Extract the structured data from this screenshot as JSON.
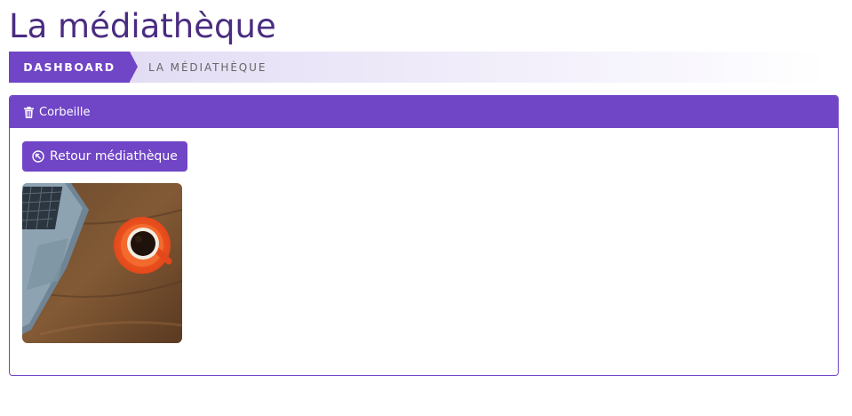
{
  "page": {
    "title": "La médiathèque"
  },
  "breadcrumb": {
    "items": [
      {
        "label": "DASHBOARD"
      },
      {
        "label": "LA MÉDIATHÈQUE"
      }
    ]
  },
  "panel": {
    "title": "Corbeille",
    "icon": "trash-icon"
  },
  "actions": {
    "back_label": "Retour médiathèque",
    "back_icon": "return-icon"
  },
  "media": {
    "items": [
      {
        "kind": "image",
        "subject": "laptop and orange coffee cup on wooden table"
      }
    ]
  },
  "colors": {
    "accent": "#7045c6",
    "title": "#4a2c80"
  }
}
